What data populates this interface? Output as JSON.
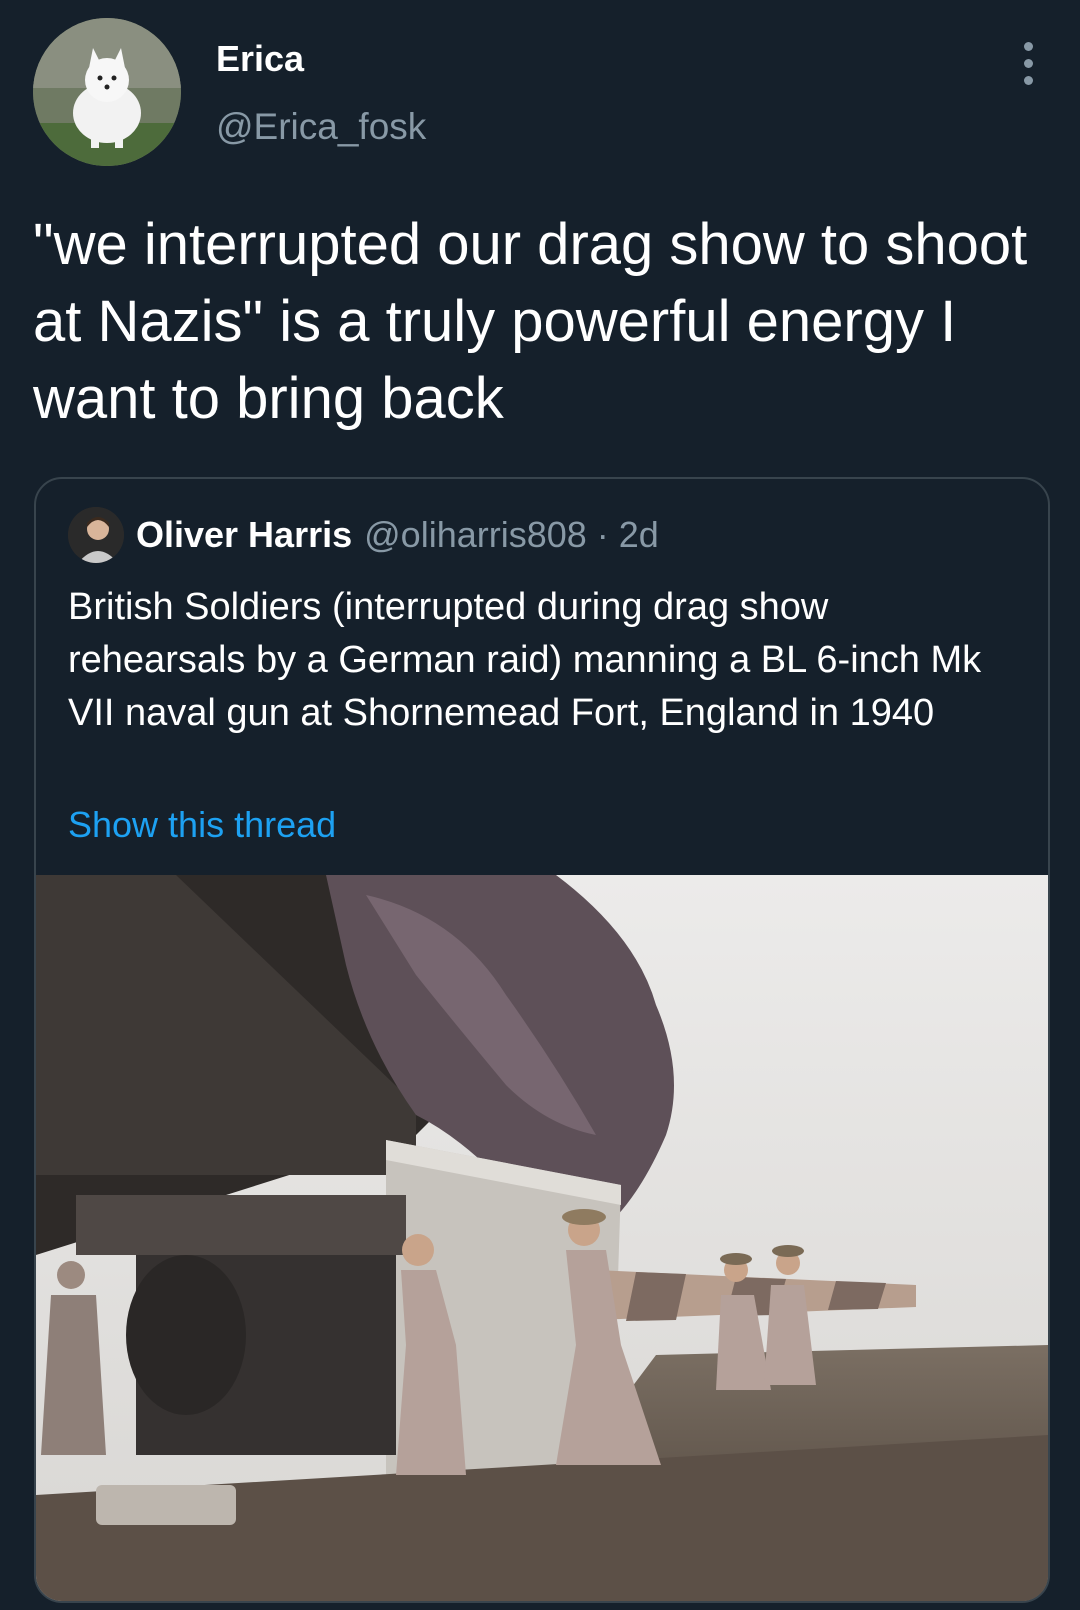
{
  "author": {
    "name": "Erica",
    "handle": "@Erica_fosk",
    "avatar_icon": "arctic-fox-avatar"
  },
  "tweet": {
    "text": "\"we interrupted our drag show to shoot at Nazis\" is a truly powerful energy I want to bring back"
  },
  "menu": {
    "icon": "more-vertical-icon"
  },
  "quoted": {
    "name": "Oliver Harris",
    "handle_time": "@oliharris808 · 2d",
    "text": "British Soldiers (interrupted during drag show rehearsals by a German raid) manning a BL 6-inch Mk VII naval gun at Shornemead Fort, England in 1940",
    "show_thread": "Show this thread",
    "image_icon": "soldiers-naval-gun-photo"
  },
  "colors": {
    "background": "#15202b",
    "text_primary": "#ffffff",
    "text_secondary": "#8899a6",
    "link": "#1da1f2",
    "border": "#38444d"
  }
}
